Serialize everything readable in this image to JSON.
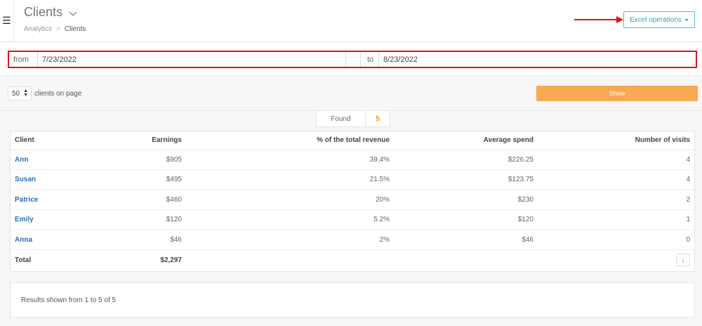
{
  "header": {
    "menu_icon": "hamburger-icon",
    "title": "Clients",
    "title_icon": "chevron-down-icon",
    "breadcrumb": {
      "parent": "Analytics",
      "separator": ">",
      "current": "Clients"
    },
    "excel_label": "Excel operations",
    "annotation_color": "#e0131b"
  },
  "filters": {
    "from_label": "from",
    "from_value": "7/23/2022",
    "to_label": "to",
    "to_value": "8/23/2022"
  },
  "controls": {
    "per_page_value": "50",
    "per_page_label": "clients on page",
    "show_label": "Show",
    "show_color": "#f7a953"
  },
  "found": {
    "label": "Found",
    "count": "5"
  },
  "table": {
    "columns": [
      "Client",
      "Earnings",
      "% of the total revenue",
      "Average spend",
      "Number of visits"
    ],
    "rows": [
      {
        "client": "Ann",
        "earnings": "$905",
        "percent": "39.4%",
        "avg": "$226.25",
        "visits": "4"
      },
      {
        "client": "Susan",
        "earnings": "$495",
        "percent": "21.5%",
        "avg": "$123.75",
        "visits": "4"
      },
      {
        "client": "Patrice",
        "earnings": "$460",
        "percent": "20%",
        "avg": "$230",
        "visits": "2"
      },
      {
        "client": "Emily",
        "earnings": "$120",
        "percent": "5.2%",
        "avg": "$120",
        "visits": "1"
      },
      {
        "client": "Anna",
        "earnings": "$46",
        "percent": "2%",
        "avg": "$46",
        "visits": "0"
      }
    ],
    "total": {
      "label": "Total",
      "earnings": "$2,297"
    },
    "download_icon": "arrow-down-icon"
  },
  "footer": {
    "results_text": "Results shown from 1 to 5 of 5"
  }
}
